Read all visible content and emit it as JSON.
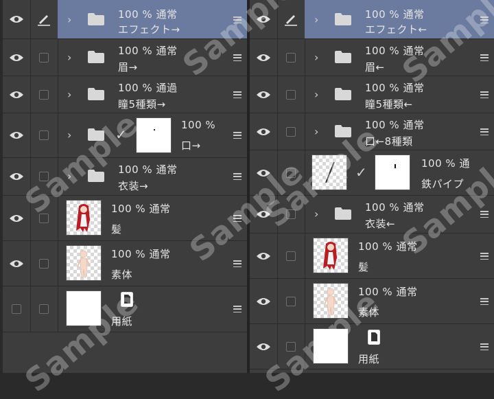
{
  "watermark_text": "Sample",
  "colors": {
    "panel_bg": "#3d3d3d",
    "selected_bg": "#6b7ba0",
    "text": "#e4e4e4"
  },
  "left_panel": {
    "layers": [
      {
        "type": "folder",
        "opacity": "100 %",
        "blend": "通常",
        "name": "エフェクト→",
        "selected": true,
        "visible": true
      },
      {
        "type": "folder",
        "opacity": "100 %",
        "blend": "通常",
        "name": "眉→",
        "visible": true
      },
      {
        "type": "folder",
        "opacity": "100 %",
        "blend": "通過",
        "name": "瞳5種類→",
        "visible": true
      },
      {
        "type": "folder",
        "opacity": "100 %",
        "blend": "",
        "name": "口→",
        "visible": true
      },
      {
        "type": "folder",
        "opacity": "100 %",
        "blend": "通常",
        "name": "衣装→",
        "visible": true
      },
      {
        "type": "raster",
        "opacity": "100 %",
        "blend": "通常",
        "name": "髪",
        "visible": true
      },
      {
        "type": "raster",
        "opacity": "100 %",
        "blend": "通常",
        "name": "素体",
        "visible": true
      },
      {
        "type": "paper",
        "opacity": "",
        "blend": "",
        "name": "用紙",
        "visible": false
      }
    ]
  },
  "right_panel": {
    "layers": [
      {
        "type": "folder",
        "opacity": "100 %",
        "blend": "通常",
        "name": "エフェクト←",
        "selected": true,
        "visible": true
      },
      {
        "type": "folder",
        "opacity": "100 %",
        "blend": "通常",
        "name": "眉←",
        "visible": true
      },
      {
        "type": "folder",
        "opacity": "100 %",
        "blend": "通常",
        "name": "瞳5種類←",
        "visible": true
      },
      {
        "type": "folder",
        "opacity": "100 %",
        "blend": "通常",
        "name": "口←8種類",
        "visible": true
      },
      {
        "type": "raster-mask",
        "opacity": "100 %",
        "blend": "通",
        "name": "鉄パイプ",
        "visible": true
      },
      {
        "type": "folder",
        "opacity": "100 %",
        "blend": "通常",
        "name": "衣装←",
        "visible": true
      },
      {
        "type": "raster",
        "opacity": "100 %",
        "blend": "通常",
        "name": "髪",
        "visible": true
      },
      {
        "type": "raster",
        "opacity": "100 %",
        "blend": "通常",
        "name": "素体",
        "visible": true
      },
      {
        "type": "paper",
        "opacity": "",
        "blend": "",
        "name": "用紙",
        "visible": true
      }
    ]
  }
}
